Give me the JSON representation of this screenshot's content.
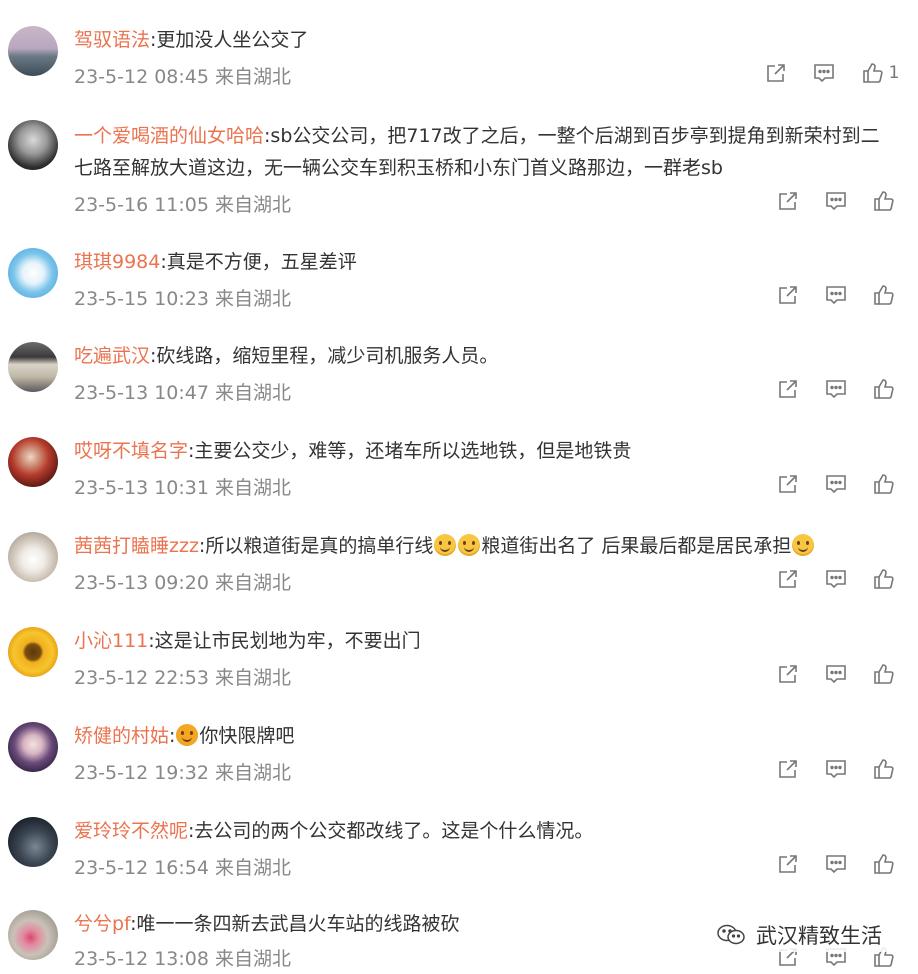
{
  "comments": [
    {
      "user": "驾驭语法",
      "text": ":更加没人坐公交了",
      "time": "23-5-12 08:45",
      "loc": "来自湖北",
      "likes": "1"
    },
    {
      "user": "一个爱喝酒的仙女哈哈",
      "text": ":sb公交公司，把717改了之后，一整个后湖到百步亭到提角到新荣村到二七路至解放大道这边，无一辆公交车到积玉桥和小东门首义路那边，一群老sb",
      "time": "23-5-16 11:05",
      "loc": "来自湖北",
      "likes": ""
    },
    {
      "user": "琪琪9984",
      "text": ":真是不方便，五星差评",
      "time": "23-5-15 10:23",
      "loc": "来自湖北",
      "likes": ""
    },
    {
      "user": "吃遍武汉",
      "text": ":砍线路，缩短里程，减少司机服务人员。",
      "time": "23-5-13 10:47",
      "loc": "来自湖北",
      "likes": ""
    },
    {
      "user": "哎呀不填名字",
      "text": ":主要公交少，难等，还堵车所以选地铁，但是地铁贵",
      "time": "23-5-13 10:31",
      "loc": "来自湖北",
      "likes": ""
    },
    {
      "user": "茜茜打瞌睡zzz",
      "text_parts": [
        ":所以粮道街是真的搞单行线",
        "",
        "粮道街出名了 后果最后都是居民承担",
        ""
      ],
      "time": "23-5-13 09:20",
      "loc": "来自湖北",
      "likes": ""
    },
    {
      "user": "小沁111",
      "text": ":这是让市民划地为牢，不要出门",
      "time": "23-5-12 22:53",
      "loc": "来自湖北",
      "likes": ""
    },
    {
      "user": "矫健的村姑",
      "text": "你快限牌吧",
      "time": "23-5-12 19:32",
      "loc": "来自湖北",
      "likes": ""
    },
    {
      "user": "爱玲玲不然呢",
      "text": ":去公司的两个公交都改线了。这是个什么情况。",
      "time": "23-5-12 16:54",
      "loc": "来自湖北",
      "likes": ""
    },
    {
      "user": "兮兮pf",
      "text": ":唯一一条四新去武昌火车站的线路被砍",
      "time": "23-5-12 13:08",
      "loc": "来自湖北",
      "likes": ""
    }
  ],
  "watermark": "武汉精致生活",
  "icons": {
    "share": "share-icon",
    "comment": "comment-icon",
    "like": "thumbs-up-icon",
    "watermark": "wechat-icon"
  },
  "colors": {
    "username": "#eb7350",
    "meta": "#888888",
    "icon": "#777777"
  }
}
